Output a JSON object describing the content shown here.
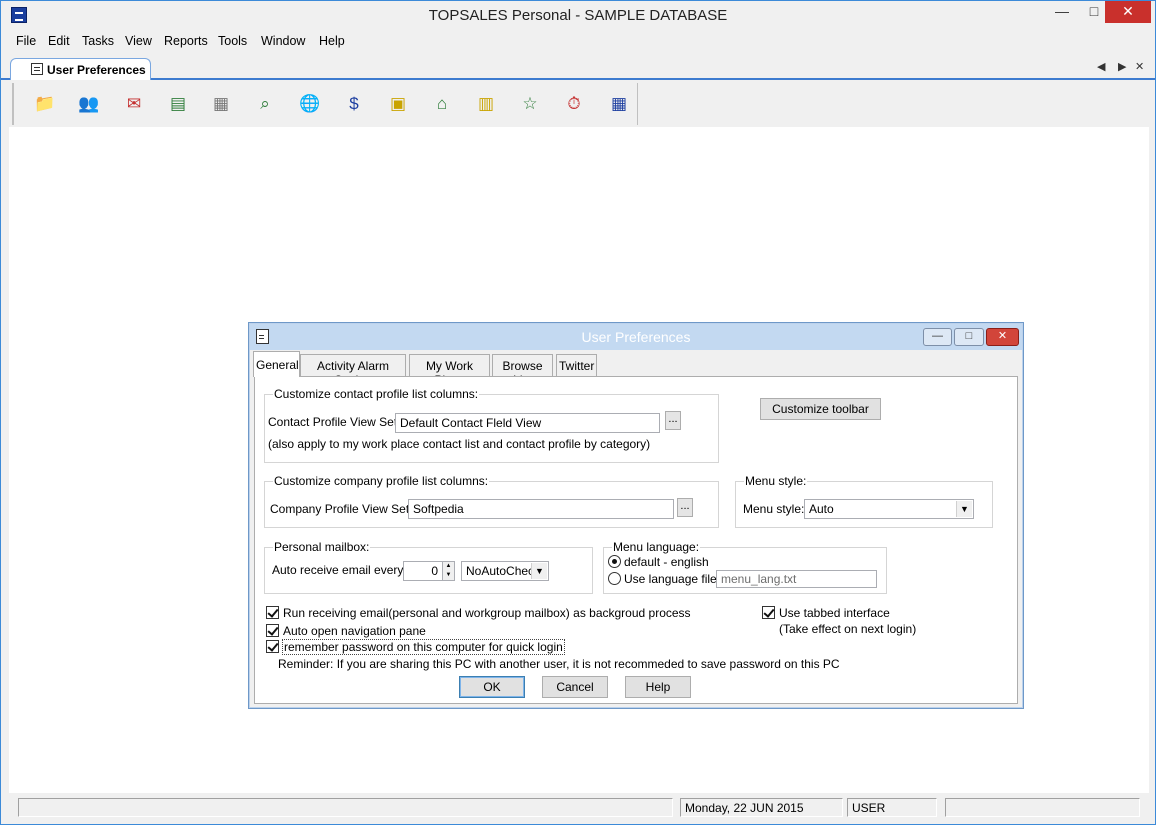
{
  "window": {
    "title": "TOPSALES Personal - SAMPLE DATABASE",
    "minimize": "—",
    "maximize": "□",
    "close": "✕"
  },
  "menu": [
    "File",
    "Edit",
    "Tasks",
    "View",
    "Reports",
    "Tools",
    "Window",
    "Help"
  ],
  "doc_tab": {
    "label": "User Preferences",
    "prev": "◀",
    "next": "▶",
    "close": "✕"
  },
  "toolbar": [
    {
      "icon": "contacts-folder-icon",
      "glyph": "📁",
      "color": "#c9a24a"
    },
    {
      "icon": "users-icon",
      "glyph": "👥",
      "color": "#e08a2e"
    },
    {
      "icon": "envelope-pen-icon",
      "glyph": "✉",
      "color": "#c53030"
    },
    {
      "icon": "address-card-icon",
      "glyph": "▤",
      "color": "#2f7d3a"
    },
    {
      "icon": "calendar-icon",
      "glyph": "▦",
      "color": "#777777"
    },
    {
      "icon": "magnifier-icon",
      "glyph": "⌕",
      "color": "#2f7d3a"
    },
    {
      "icon": "globe-computer-icon",
      "glyph": "🌐",
      "color": "#2266cc"
    },
    {
      "icon": "dollar-document-icon",
      "glyph": "$",
      "color": "#1e3fa0"
    },
    {
      "icon": "cash-register-icon",
      "glyph": "▣",
      "color": "#c9a400"
    },
    {
      "icon": "bank-icon",
      "glyph": "⌂",
      "color": "#2f7d3a"
    },
    {
      "icon": "warehouse-shelf-icon",
      "glyph": "▥",
      "color": "#c9a400"
    },
    {
      "icon": "desk-lamp-icon",
      "glyph": "☆",
      "color": "#2f7d3a"
    },
    {
      "icon": "stopwatch-icon",
      "glyph": "⏱",
      "color": "#c53030"
    },
    {
      "icon": "calculator-icon",
      "glyph": "▦",
      "color": "#1e3fa0"
    }
  ],
  "dialog": {
    "title": "User Preferences",
    "tabs": [
      "General",
      "Activity Alarm Setting",
      "My Work Place",
      "Browse List",
      "Twitter"
    ],
    "contact_group": {
      "legend": "Customize contact profile list columns:",
      "view_set_label": "Contact Profile View Set:",
      "view_set_value": "Default Contact Fleld View",
      "note": "(also apply to my work place contact list and contact profile by category)"
    },
    "customize_toolbar_button": "Customize toolbar",
    "company_group": {
      "legend": "Customize company profile list columns:",
      "view_set_label": "Company Profile View Set:",
      "view_set_value": "Softpedia"
    },
    "browse_button": "...",
    "menu_style_group": {
      "legend": "Menu style:",
      "label": "Menu style:",
      "value": "Auto"
    },
    "mailbox_group": {
      "legend": "Personal mailbox:",
      "label": "Auto receive email every:",
      "interval_value": "0",
      "mode_value": "NoAutoChec"
    },
    "language_group": {
      "legend": "Menu language:",
      "default_option": "default - english",
      "file_option": "Use language file",
      "file_value": "menu_lang.txt"
    },
    "checkboxes": {
      "run_background": "Run receiving email(personal and workgroup mailbox) as backgroud process",
      "auto_open_nav": "Auto open navigation pane",
      "remember_password": "remember password on this computer for quick login",
      "use_tabbed": "Use tabbed interface",
      "tabbed_note": "(Take effect on next login)"
    },
    "reminder": "Reminder: If you are sharing this PC with another user, it is not recommeded to save password on this PC",
    "ok_button": "OK",
    "cancel_button": "Cancel",
    "help_button": "Help",
    "win_min": "—",
    "win_max": "□",
    "win_close": "✕"
  },
  "status": {
    "panel1": "",
    "date": "Monday, 22 JUN 2015",
    "user": "USER",
    "panel4": ""
  }
}
